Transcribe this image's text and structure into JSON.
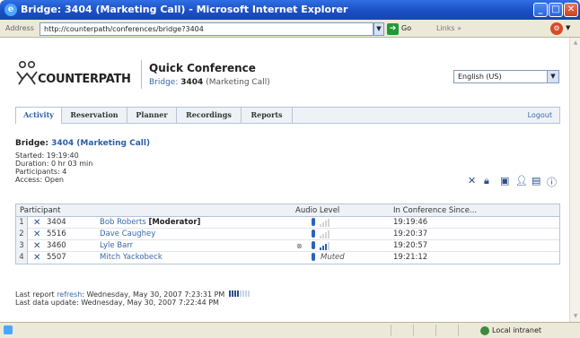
{
  "window": {
    "title": "Bridge: 3404 (Marketing Call) - Microsoft Internet Explorer"
  },
  "browser": {
    "address_label": "Address",
    "url": "http://counterpath/conferences/bridge?3404",
    "go_label": "Go",
    "links_label": "Links »",
    "status_zone": "Local intranet"
  },
  "header": {
    "logo_text": "COUNTERPATH",
    "app_title": "Quick Conference",
    "bridge_label": "Bridge:",
    "bridge_number": "3404",
    "bridge_name": "(Marketing Call)",
    "language": "English (US)"
  },
  "tabs": [
    {
      "label": "Activity",
      "active": true
    },
    {
      "label": "Reservation",
      "active": false
    },
    {
      "label": "Planner",
      "active": false
    },
    {
      "label": "Recordings",
      "active": false
    },
    {
      "label": "Reports",
      "active": false
    }
  ],
  "logout_label": "Logout",
  "bridge": {
    "heading_label": "Bridge:",
    "heading_value": "3404 (Marketing Call)",
    "started": "Started: 19:19:40",
    "duration": "Duration: 0 hr 03 min",
    "participants": "Participants: 4",
    "access": "Access: Open"
  },
  "action_icons": [
    "close-icon",
    "lock-icon",
    "record-icon",
    "add-participant-icon",
    "list-icon",
    "help-icon"
  ],
  "table": {
    "headers": {
      "participant": "Participant",
      "audio": "Audio Level",
      "since": "In Conference Since..."
    },
    "rows": [
      {
        "num": "1",
        "ext": "3404",
        "name": "Bob Roberts",
        "role": "[Moderator]",
        "recording": false,
        "level": 0,
        "muted": false,
        "since": "19:19:46"
      },
      {
        "num": "2",
        "ext": "5516",
        "name": "Dave Caughey",
        "role": "",
        "recording": false,
        "level": 0,
        "muted": false,
        "since": "19:20:37"
      },
      {
        "num": "3",
        "ext": "3460",
        "name": "Lyle Barr",
        "role": "",
        "recording": true,
        "level": 3,
        "muted": false,
        "since": "19:20:57"
      },
      {
        "num": "4",
        "ext": "5507",
        "name": "Mitch Yackobeck",
        "role": "",
        "recording": false,
        "level": 0,
        "muted": true,
        "muted_label": "Muted",
        "since": "19:21:12"
      }
    ]
  },
  "footer": {
    "last_report_prefix": "Last report",
    "refresh_label": "refresh",
    "last_report_suffix": ": Wednesday, May 30, 2007 7:23:31 PM",
    "refresh_progress": 0.5,
    "last_data_update": "Last data update: Wednesday, May 30, 2007 7:22:44 PM"
  }
}
